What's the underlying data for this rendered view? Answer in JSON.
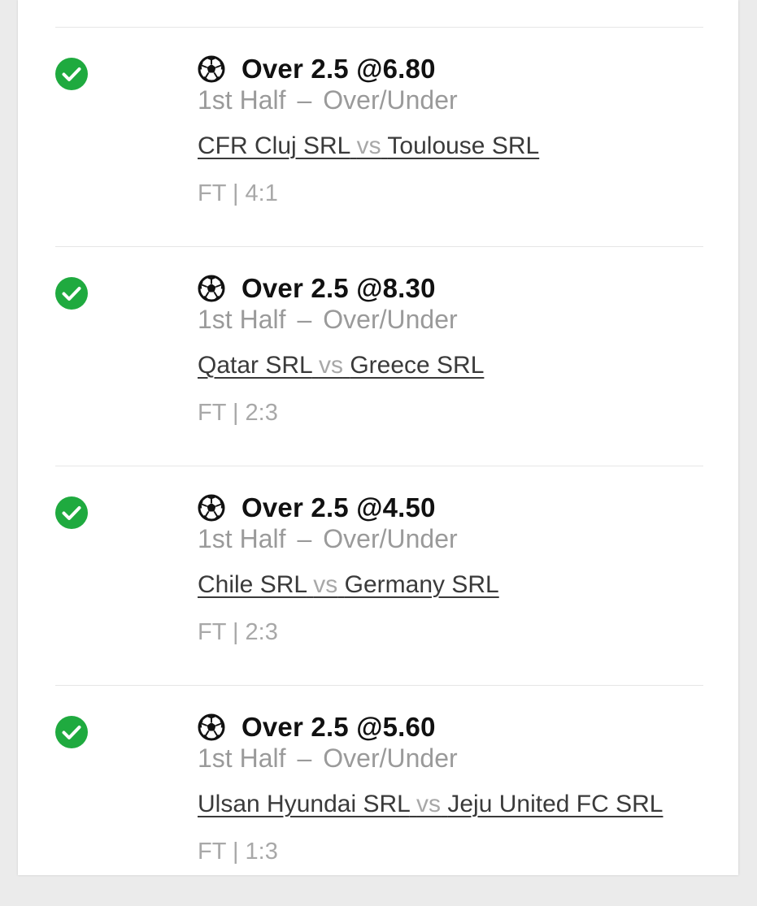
{
  "colors": {
    "check_green": "#1faa3f",
    "pick_text": "#111111",
    "muted_text": "#9a9a9a",
    "match_text": "#3a3a3a"
  },
  "bets": [
    {
      "status_icon": "check-circle-icon",
      "sport_icon": "soccer-ball-icon",
      "pick": "Over 2.5 @6.80",
      "period": "1st Half",
      "separator": "–",
      "market": "Over/Under",
      "home_team": "CFR Cluj SRL",
      "vs": "vs",
      "away_team": "Toulouse SRL",
      "result": "FT | 4:1"
    },
    {
      "status_icon": "check-circle-icon",
      "sport_icon": "soccer-ball-icon",
      "pick": "Over 2.5 @8.30",
      "period": "1st Half",
      "separator": "–",
      "market": "Over/Under",
      "home_team": "Qatar SRL",
      "vs": "vs",
      "away_team": "Greece SRL",
      "result": "FT | 2:3"
    },
    {
      "status_icon": "check-circle-icon",
      "sport_icon": "soccer-ball-icon",
      "pick": "Over 2.5 @4.50",
      "period": "1st Half",
      "separator": "–",
      "market": "Over/Under",
      "home_team": "Chile SRL",
      "vs": "vs",
      "away_team": "Germany SRL",
      "result": "FT | 2:3"
    },
    {
      "status_icon": "check-circle-icon",
      "sport_icon": "soccer-ball-icon",
      "pick": "Over 2.5 @5.60",
      "period": "1st Half",
      "separator": "–",
      "market": "Over/Under",
      "home_team": "Ulsan Hyundai SRL",
      "vs": "vs",
      "away_team": "Jeju United FC SRL",
      "result": "FT | 1:3"
    }
  ]
}
